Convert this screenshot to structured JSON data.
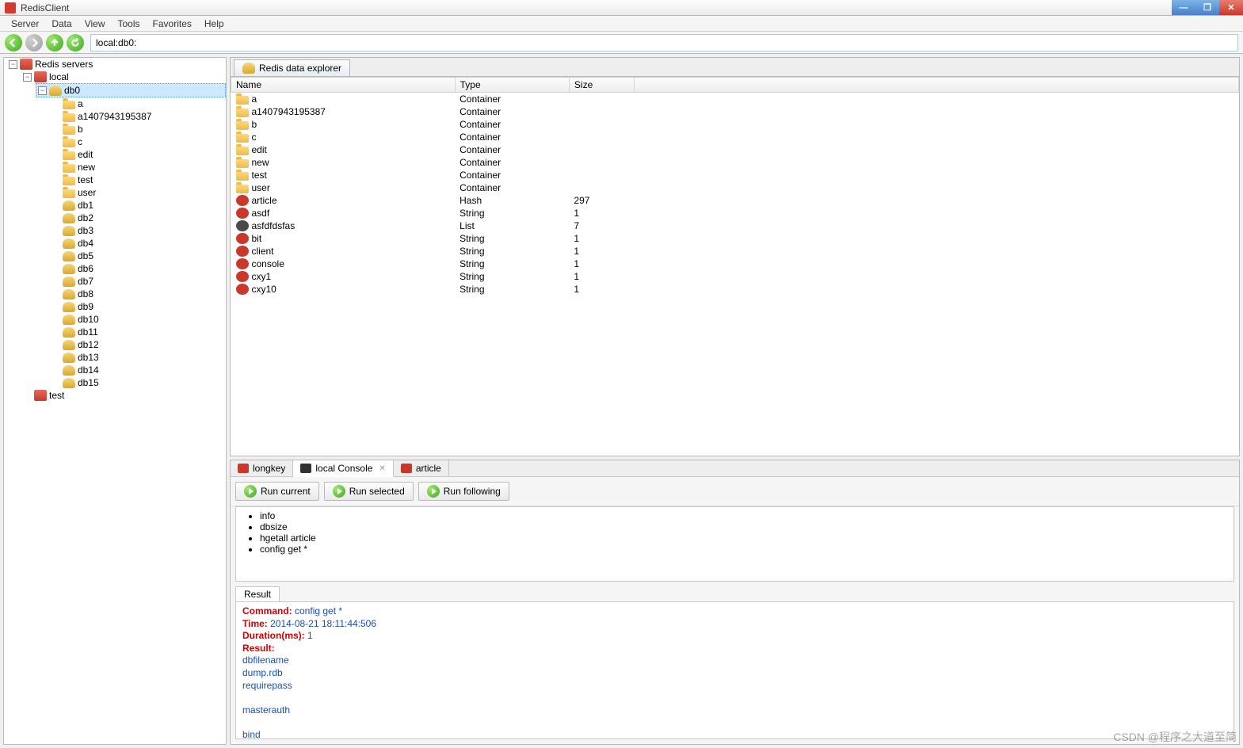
{
  "title": "RedisClient",
  "menu": [
    "Server",
    "Data",
    "View",
    "Tools",
    "Favorites",
    "Help"
  ],
  "breadcrumb": "local:db0:",
  "tree": {
    "root": "Redis servers",
    "local": "local",
    "test": "test",
    "db0": "db0",
    "db0_children": [
      "a",
      "a1407943195387",
      "b",
      "c",
      "edit",
      "new",
      "test",
      "user"
    ],
    "dbs": [
      "db1",
      "db2",
      "db3",
      "db4",
      "db5",
      "db6",
      "db7",
      "db8",
      "db9",
      "db10",
      "db11",
      "db12",
      "db13",
      "db14",
      "db15"
    ]
  },
  "explorer_tab": "Redis data explorer",
  "columns": [
    "Name",
    "Type",
    "Size"
  ],
  "rows": [
    {
      "name": "a",
      "type": "Container",
      "size": "",
      "icon": "ki-fld"
    },
    {
      "name": "a1407943195387",
      "type": "Container",
      "size": "",
      "icon": "ki-fld"
    },
    {
      "name": "b",
      "type": "Container",
      "size": "",
      "icon": "ki-fld"
    },
    {
      "name": "c",
      "type": "Container",
      "size": "",
      "icon": "ki-fld"
    },
    {
      "name": "edit",
      "type": "Container",
      "size": "",
      "icon": "ki-fld"
    },
    {
      "name": "new",
      "type": "Container",
      "size": "",
      "icon": "ki-fld"
    },
    {
      "name": "test",
      "type": "Container",
      "size": "",
      "icon": "ki-fld"
    },
    {
      "name": "user",
      "type": "Container",
      "size": "",
      "icon": "ki-fld"
    },
    {
      "name": "article",
      "type": "Hash",
      "size": "297",
      "icon": "ki-hash"
    },
    {
      "name": "asdf",
      "type": "String",
      "size": "1",
      "icon": "ki-str"
    },
    {
      "name": "asfdfdsfas",
      "type": "List",
      "size": "7",
      "icon": "ki-list"
    },
    {
      "name": "bit",
      "type": "String",
      "size": "1",
      "icon": "ki-str"
    },
    {
      "name": "client",
      "type": "String",
      "size": "1",
      "icon": "ki-str"
    },
    {
      "name": "console",
      "type": "String",
      "size": "1",
      "icon": "ki-str"
    },
    {
      "name": "cxy1",
      "type": "String",
      "size": "1",
      "icon": "ki-str"
    },
    {
      "name": "cxy10",
      "type": "String",
      "size": "1",
      "icon": "ki-str"
    }
  ],
  "btabs": [
    {
      "label": "longkey",
      "icon": "bi-str"
    },
    {
      "label": "local Console",
      "icon": "bi-con",
      "active": true,
      "closable": true
    },
    {
      "label": "article",
      "icon": "bi-hash"
    }
  ],
  "run_buttons": [
    "Run current",
    "Run selected",
    "Run following"
  ],
  "commands": [
    "info",
    "dbsize",
    "hgetall article",
    "config get *"
  ],
  "result_tab": "Result",
  "result": {
    "command_label": "Command:",
    "command_val": " config get *",
    "time_label": "Time:",
    "time_val": " 2014-08-21 18:11:44:506",
    "dur_label": "Duration(ms):",
    "dur_val": " 1",
    "res_label": "Result:",
    "lines": [
      "dbfilename",
      "dump.rdb",
      "requirepass",
      "",
      "masterauth",
      "",
      "bind"
    ]
  },
  "watermark": "CSDN @程序之大道至简"
}
